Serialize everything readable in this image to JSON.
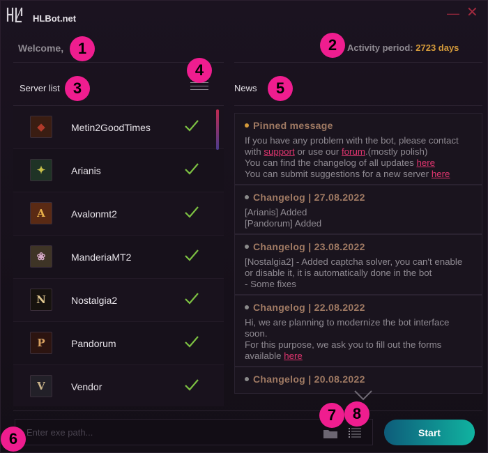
{
  "app": {
    "title": "HLBot.net"
  },
  "window": {
    "minimize_symbol": "—",
    "close_symbol": "✕"
  },
  "header": {
    "welcome": "Welcome,",
    "activity_label": "Activity period:",
    "activity_value": "2723 days"
  },
  "server_panel": {
    "title": "Server list",
    "menu_icon": "hamburger-menu-icon",
    "servers": [
      {
        "name": "Metin2GoodTimes",
        "icon_glyph": "◆",
        "icon_color": "#b03a2a",
        "icon_bg": "#3a1d12",
        "status": "check"
      },
      {
        "name": "Arianis",
        "icon_glyph": "✦",
        "icon_color": "#c8c04a",
        "icon_bg": "#1f3326",
        "status": "check"
      },
      {
        "name": "Avalonmt2",
        "icon_glyph": "A",
        "icon_color": "#e8b04a",
        "icon_bg": "#5a2a14",
        "status": "check"
      },
      {
        "name": "ManderiaMT2",
        "icon_glyph": "❀",
        "icon_color": "#d6a9c8",
        "icon_bg": "#3e3426",
        "status": "check"
      },
      {
        "name": "Nostalgia2",
        "icon_glyph": "N",
        "icon_color": "#e0c890",
        "icon_bg": "#16120e",
        "status": "check"
      },
      {
        "name": "Pandorum",
        "icon_glyph": "P",
        "icon_color": "#d8a060",
        "icon_bg": "#2c1410",
        "status": "check"
      },
      {
        "name": "Vendor",
        "icon_glyph": "V",
        "icon_color": "#c9b48a",
        "icon_bg": "#222028",
        "status": "check"
      }
    ]
  },
  "news_panel": {
    "title": "News",
    "items": [
      {
        "heading": "Pinned message",
        "pinned": true,
        "lines": [
          {
            "parts": [
              {
                "text": "If you have any problem with the bot, please contact with "
              },
              {
                "text": "support",
                "link": true
              },
              {
                "text": " or use our "
              },
              {
                "text": "forum",
                "link": true
              },
              {
                "text": ".(mostly polish)"
              }
            ]
          },
          {
            "parts": [
              {
                "text": "You can find the changelog of all updates "
              },
              {
                "text": "here",
                "link": true
              }
            ]
          },
          {
            "parts": [
              {
                "text": "You can submit suggestions for a new server "
              },
              {
                "text": "here",
                "link": true
              }
            ]
          }
        ]
      },
      {
        "heading": "Changelog | 27.08.2022",
        "pinned": false,
        "lines": [
          {
            "parts": [
              {
                "text": "[Arianis] Added"
              }
            ]
          },
          {
            "parts": [
              {
                "text": "[Pandorum] Added"
              }
            ]
          }
        ]
      },
      {
        "heading": "Changelog | 23.08.2022",
        "pinned": false,
        "lines": [
          {
            "parts": [
              {
                "text": "[Nostalgia2] - Added captcha solver, you can't enable or disable it, it is automatically done in the bot"
              }
            ]
          },
          {
            "parts": [
              {
                "text": "- Some fixes"
              }
            ]
          }
        ]
      },
      {
        "heading": "Changelog | 22.08.2022",
        "pinned": false,
        "lines": [
          {
            "parts": [
              {
                "text": "Hi, we are planning to modernize the bot interface soon."
              }
            ]
          },
          {
            "parts": [
              {
                "text": "For this purpose, we ask you to fill out the forms available "
              },
              {
                "text": "here",
                "link": true
              }
            ]
          }
        ]
      },
      {
        "heading": "Changelog | 20.08.2022",
        "pinned": false,
        "lines": []
      }
    ]
  },
  "footer": {
    "exe_placeholder": "Enter exe path...",
    "exe_value": "",
    "browse_icon": "folder-icon",
    "list_icon": "list-icon",
    "start_label": "Start"
  },
  "annotations": [
    "1",
    "2",
    "3",
    "4",
    "5",
    "6",
    "7",
    "8"
  ],
  "colors": {
    "accent": "#ef1d8f",
    "link": "#e0356f",
    "days": "#d49a3a",
    "check": "#7cc042",
    "start_gradient_left": "#0e5c7a",
    "start_gradient_right": "#10b3a0"
  }
}
